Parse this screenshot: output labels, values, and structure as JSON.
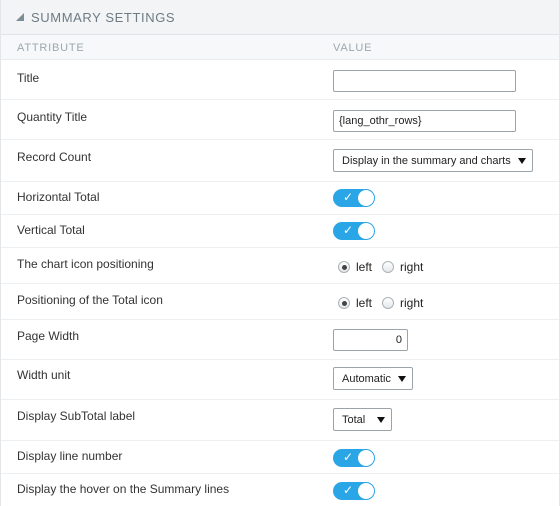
{
  "panel": {
    "title": "SUMMARY SETTINGS",
    "collapse_icon": "triangle-down-icon"
  },
  "columns": {
    "attribute": "ATTRIBUTE",
    "value": "VALUE"
  },
  "rows": [
    {
      "label": "Title",
      "control": "text",
      "value": ""
    },
    {
      "label": "Quantity Title",
      "control": "text",
      "value": "{lang_othr_rows}"
    },
    {
      "label": "Record Count",
      "control": "select",
      "value": "Display in the summary and charts"
    },
    {
      "label": "Horizontal Total",
      "control": "toggle",
      "value": "on"
    },
    {
      "label": "Vertical Total",
      "control": "toggle",
      "value": "on"
    },
    {
      "label": "The chart icon positioning",
      "control": "radio",
      "options": [
        "left",
        "right"
      ],
      "selected": "left"
    },
    {
      "label": "Positioning of the Total icon",
      "control": "radio",
      "options": [
        "left",
        "right"
      ],
      "selected": "left"
    },
    {
      "label": "Page Width",
      "control": "number",
      "value": "0"
    },
    {
      "label": "Width unit",
      "control": "select",
      "value": "Automatic"
    },
    {
      "label": "Display SubTotal label",
      "control": "select",
      "value": "Total"
    },
    {
      "label": "Display line number",
      "control": "toggle",
      "value": "on"
    },
    {
      "label": "Display the hover on the Summary lines",
      "control": "toggle",
      "value": "on"
    }
  ],
  "toggle": {
    "check_glyph": "✓",
    "accent_color": "#2aa6e6"
  }
}
